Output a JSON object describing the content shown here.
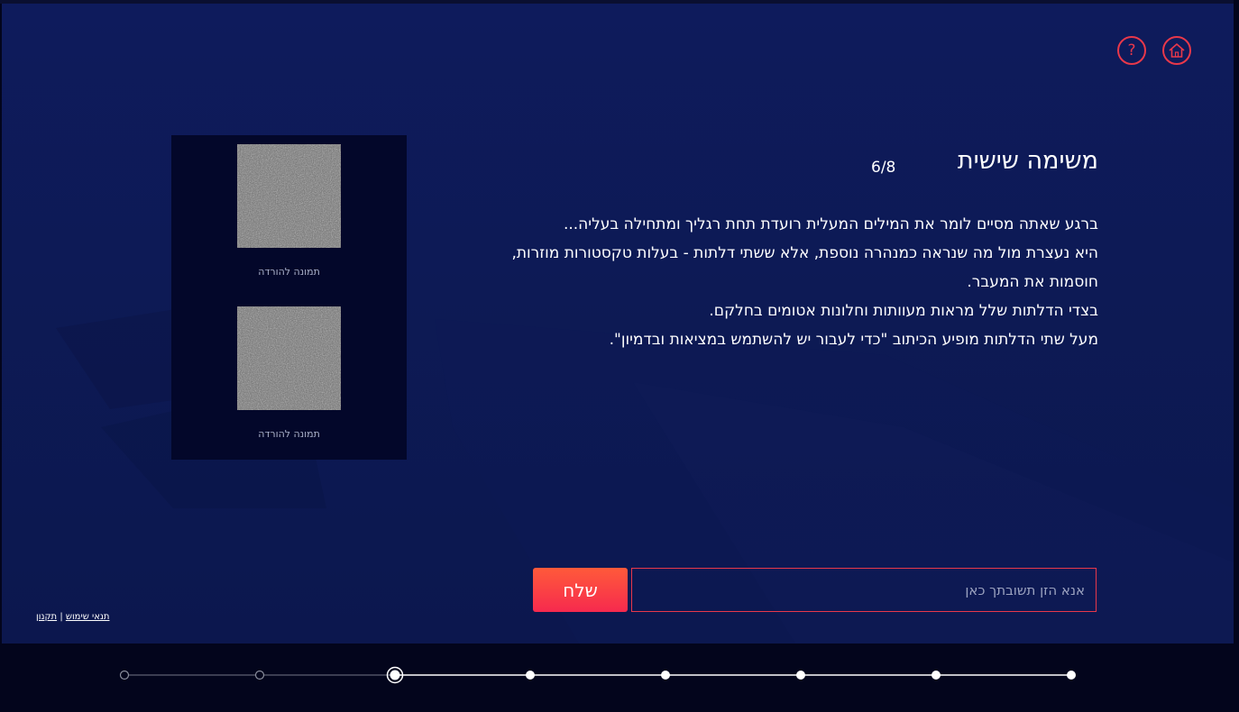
{
  "header": {
    "help_icon": "question-mark-icon",
    "home_icon": "home-icon",
    "accent_color": "#e8384a"
  },
  "images": [
    {
      "caption": "תמונה להורדה"
    },
    {
      "caption": "תמונה להורדה"
    }
  ],
  "task": {
    "title": "משימה שישית",
    "counter": "6/8",
    "paragraphs": [
      "ברגע שאתה מסיים לומר את המילים המעלית רועדת תחת רגליך ומתחילה בעליה...",
      "היא נעצרת מול מה שנראה כמנהרה נוספת, אלא ששתי דלתות - בעלות טקסטורות מוזרות, חוסמות את המעבר.",
      "בצדי הדלתות שלל מראות מעוותות וחלונות אטומים בחלקם.",
      "מעל שתי הדלתות מופיע הכיתוב \"כדי לעבור יש להשתמש במציאות ובדמיון\"."
    ]
  },
  "answer": {
    "placeholder": "אנא הזן תשובתך כאן",
    "value": "",
    "send_label": "שלח",
    "button_color": "#f62a4e"
  },
  "footer": {
    "terms_label": "תנאי שימוש",
    "separator": "|",
    "rules_label": "תקנון"
  },
  "progress": {
    "total_steps": 8,
    "current_step": 6,
    "completed_steps": 5
  }
}
